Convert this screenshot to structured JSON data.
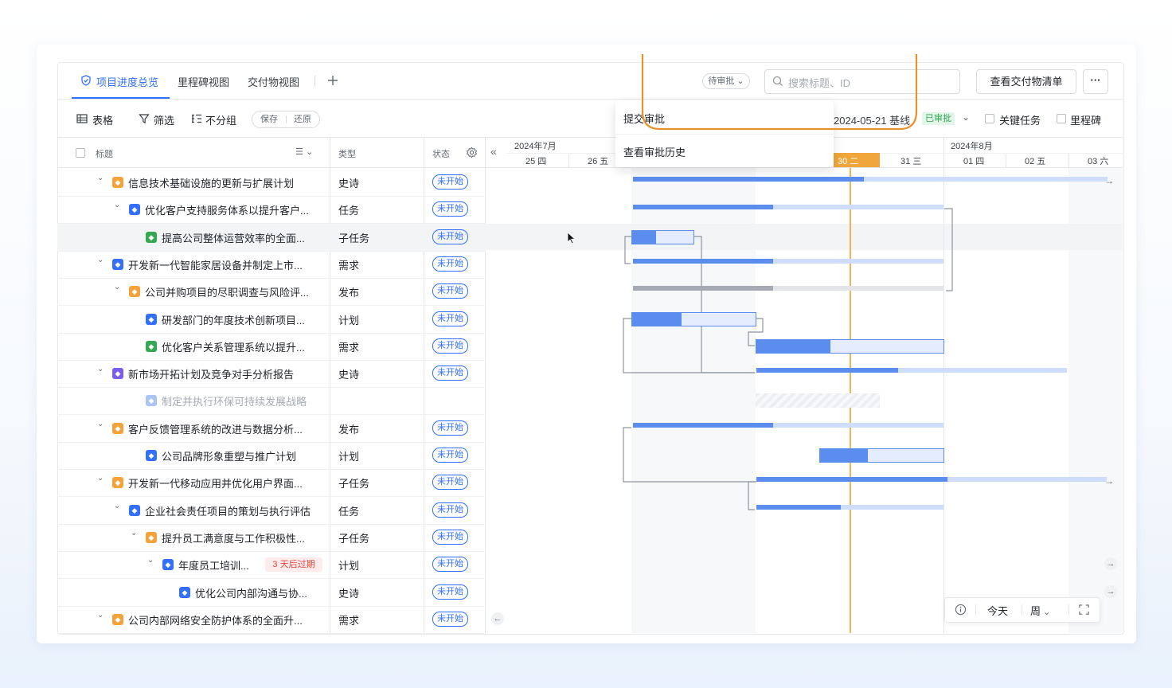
{
  "tabs": [
    {
      "label": "项目进度总览"
    },
    {
      "label": "里程碑视图"
    },
    {
      "label": "交付物视图"
    }
  ],
  "tab_add_icon": "plus-icon",
  "header": {
    "approval_badge": "待审批",
    "search_placeholder": "搜索标题、ID",
    "deliverables_button": "查看交付物清单",
    "more_icon": "ellipsis-icon"
  },
  "toolbar": {
    "table_label": "表格",
    "filter_label": "筛选",
    "group_label": "不分组",
    "save_label": "保存",
    "restore_label": "还原",
    "baseline_label": "2024-05-21 基线",
    "approved_badge": "已审批",
    "critical_task_label": "关键任务",
    "milestone_label": "里程碑"
  },
  "dropdown": {
    "items": [
      "提交审批",
      "查看审批历史"
    ]
  },
  "table": {
    "columns": {
      "title": "标题",
      "type": "类型",
      "status": "状态"
    },
    "rows": [
      {
        "title": "信息技术基础设施的更新与扩展计划",
        "type": "史诗",
        "status": "未开始"
      },
      {
        "title": "优化客户支持服务体系以提升客户...",
        "type": "任务",
        "status": "未开始"
      },
      {
        "title": "提高公司整体运营效率的全面...",
        "type": "子任务",
        "status": "未开始"
      },
      {
        "title": "开发新一代智能家居设备并制定上市...",
        "type": "需求",
        "status": "未开始"
      },
      {
        "title": "公司并购项目的尽职调查与风险评...",
        "type": "发布",
        "status": "未开始"
      },
      {
        "title": "研发部门的年度技术创新项目...",
        "type": "计划",
        "status": "未开始"
      },
      {
        "title": "优化客户关系管理系统以提升...",
        "type": "需求",
        "status": "未开始"
      },
      {
        "title": "新市场开拓计划及竞争对手分析报告",
        "type": "史诗",
        "status": "未开始"
      },
      {
        "title": "制定并执行环保可持续发展战略",
        "type": "",
        "status": ""
      },
      {
        "title": "客户反馈管理系统的改进与数据分析...",
        "type": "发布",
        "status": "未开始"
      },
      {
        "title": "公司品牌形象重塑与推广计划",
        "type": "计划",
        "status": "未开始"
      },
      {
        "title": "开发新一代移动应用并优化用户界面...",
        "type": "子任务",
        "status": "未开始"
      },
      {
        "title": "企业社会责任项目的策划与执行评估",
        "type": "任务",
        "status": "未开始"
      },
      {
        "title": "提升员工满意度与工作积极性...",
        "type": "子任务",
        "status": "未开始"
      },
      {
        "title": "年度员工培训...",
        "type": "计划",
        "status": "未开始",
        "overdue": "3 天后过期"
      },
      {
        "title": "优化公司内部沟通与协...",
        "type": "史诗",
        "status": "未开始"
      },
      {
        "title": "公司内部网络安全防护体系的全面升...",
        "type": "需求",
        "status": "未开始"
      }
    ]
  },
  "gantt": {
    "month_july": "2024年7月",
    "month_august": "2024年8月",
    "days": [
      "25 四",
      "26 五",
      "30 二",
      "31 三",
      "01 四",
      "02 五",
      "03 六"
    ],
    "collapse_icon": "double-chevron-left-icon"
  },
  "bottom_controls": {
    "info_icon": "info-icon",
    "today_label": "今天",
    "scale_label": "周",
    "fullscreen_icon": "fullscreen-icon"
  },
  "colors": {
    "accent": "#3370ff",
    "today_line": "#f0a63a",
    "bar": "#5b8def",
    "highlight_outline": "#e8912d"
  }
}
